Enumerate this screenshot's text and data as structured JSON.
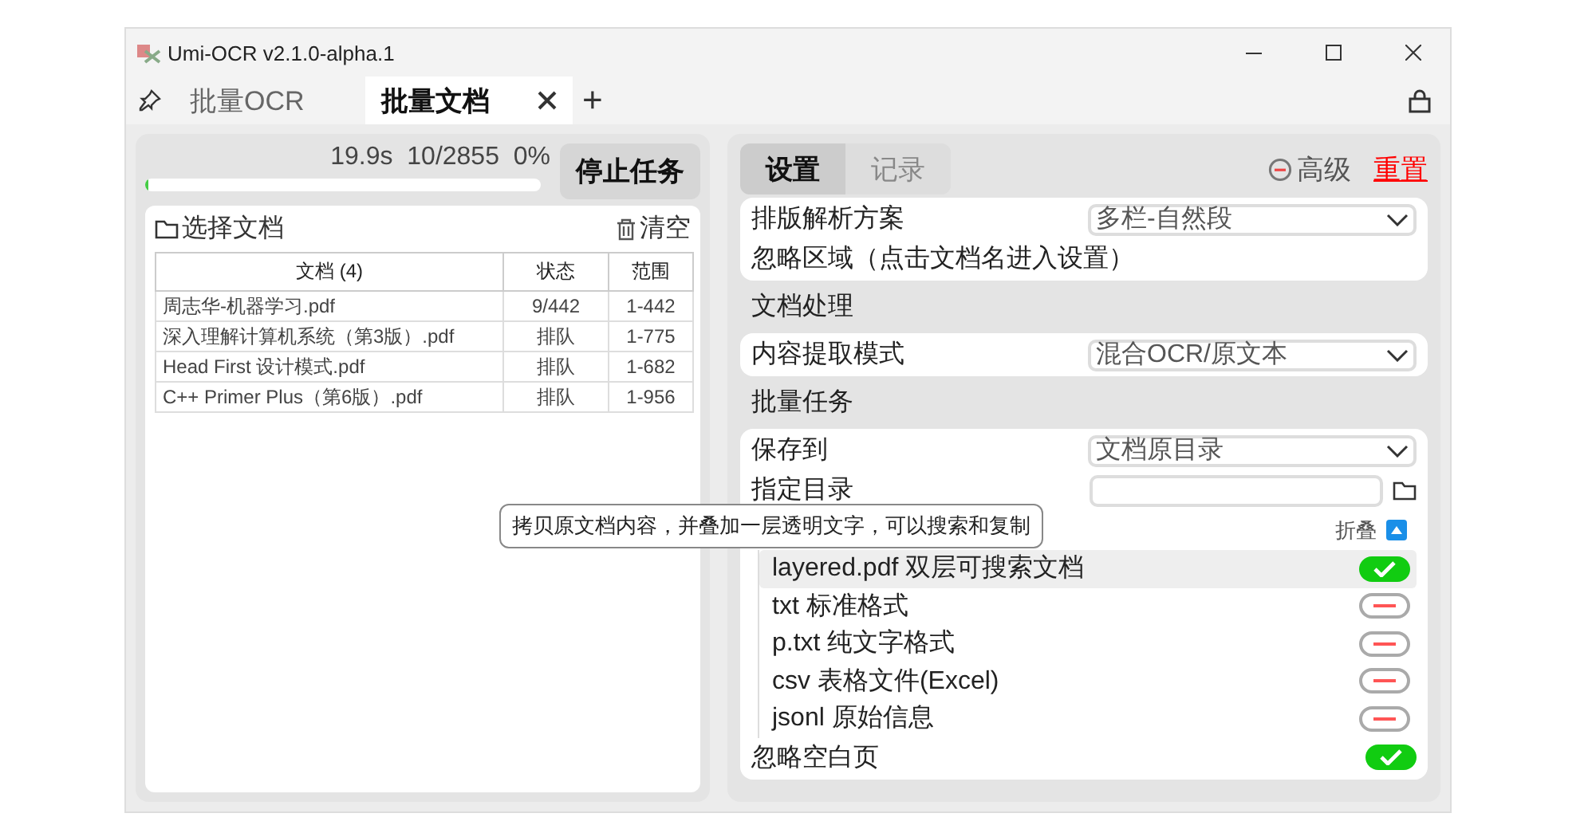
{
  "window": {
    "title": "Umi-OCR v2.1.0-alpha.1"
  },
  "tabs": [
    {
      "label": "批量OCR",
      "selected": false,
      "closable": false
    },
    {
      "label": "批量文档",
      "selected": true,
      "closable": true
    }
  ],
  "add_tab": "+",
  "task": {
    "time": "19.9s",
    "count": "10/2855",
    "percent": "0%",
    "level": 0.0035,
    "stop_button": "停止任务"
  },
  "files": {
    "choose": "选择文档",
    "clear": "清空",
    "columns": [
      "文档 (4)",
      "状态",
      "范围"
    ],
    "rows": [
      [
        "周志华-机器学习.pdf",
        "9/442",
        "1-442"
      ],
      [
        "深入理解计算机系统（第3版）.pdf",
        "排队",
        "1-775"
      ],
      [
        "Head First 设计模式.pdf",
        "排队",
        "1-682"
      ],
      [
        "C++ Primer Plus（第6版）.pdf",
        "排队",
        "1-956"
      ]
    ]
  },
  "settings": {
    "tabs": [
      {
        "label": "设置",
        "selected": true
      },
      {
        "label": "记录",
        "selected": false
      }
    ],
    "advanced": "高级",
    "reset": "重置",
    "sections": [
      {
        "kind": "card",
        "rows": [
          {
            "kind": "select",
            "label": "排版解析方案",
            "value": "多栏-自然段"
          },
          {
            "kind": "note",
            "label": "忽略区域（点击文档名进入设置）"
          }
        ]
      },
      {
        "kind": "heading",
        "label": "文档处理"
      },
      {
        "kind": "card",
        "rows": [
          {
            "kind": "select",
            "label": "内容提取模式",
            "value": "混合OCR/原文本"
          }
        ]
      },
      {
        "kind": "heading",
        "label": "批量任务"
      },
      {
        "kind": "card",
        "rows": [
          {
            "kind": "select",
            "label": "保存到",
            "value": "文档原目录"
          },
          {
            "kind": "path",
            "label": "指定目录"
          },
          {
            "kind": "collapse",
            "label": "折叠",
            "expanded": true
          },
          {
            "kind": "formats",
            "items": [
              {
                "label": "layered.pdf 双层可搜索文档",
                "on": true,
                "highlighted": true
              },
              {
                "label": "txt 标准格式",
                "on": false,
                "highlighted": false
              },
              {
                "label": "p.txt 纯文字格式",
                "on": false,
                "highlighted": false
              },
              {
                "label": "csv 表格文件(Excel)",
                "on": false,
                "highlighted": false
              },
              {
                "label": "jsonl 原始信息",
                "on": false,
                "highlighted": false
              }
            ]
          },
          {
            "kind": "switch",
            "label": "忽略空白页",
            "on": true
          }
        ]
      }
    ]
  },
  "tooltip": {
    "text": "拷贝原文档内容，并叠加一层透明文字，可以搜索和复制"
  }
}
